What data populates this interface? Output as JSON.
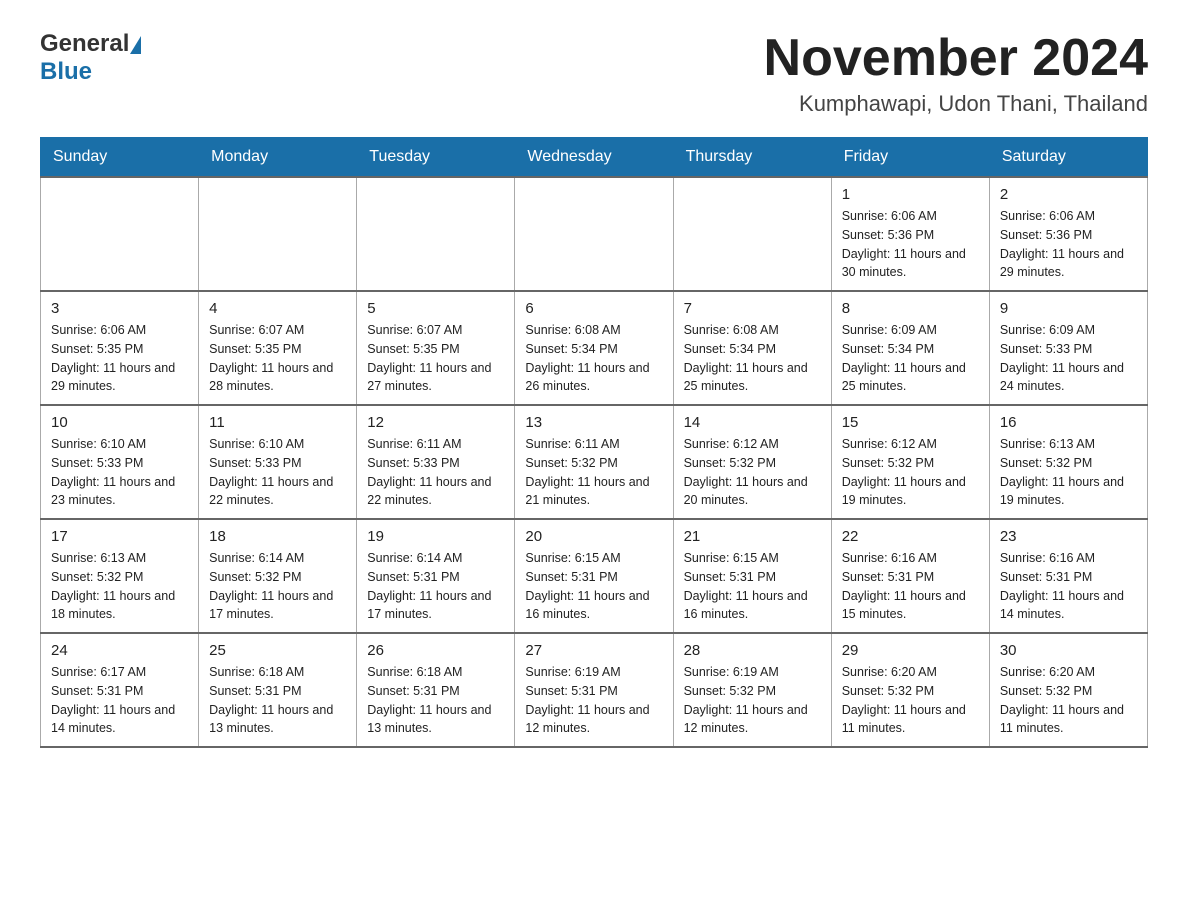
{
  "header": {
    "logo_general": "General",
    "logo_blue": "Blue",
    "title": "November 2024",
    "location": "Kumphawapi, Udon Thani, Thailand"
  },
  "days_of_week": [
    "Sunday",
    "Monday",
    "Tuesday",
    "Wednesday",
    "Thursday",
    "Friday",
    "Saturday"
  ],
  "weeks": [
    [
      {
        "day": "",
        "info": ""
      },
      {
        "day": "",
        "info": ""
      },
      {
        "day": "",
        "info": ""
      },
      {
        "day": "",
        "info": ""
      },
      {
        "day": "",
        "info": ""
      },
      {
        "day": "1",
        "info": "Sunrise: 6:06 AM\nSunset: 5:36 PM\nDaylight: 11 hours\nand 30 minutes."
      },
      {
        "day": "2",
        "info": "Sunrise: 6:06 AM\nSunset: 5:36 PM\nDaylight: 11 hours\nand 29 minutes."
      }
    ],
    [
      {
        "day": "3",
        "info": "Sunrise: 6:06 AM\nSunset: 5:35 PM\nDaylight: 11 hours\nand 29 minutes."
      },
      {
        "day": "4",
        "info": "Sunrise: 6:07 AM\nSunset: 5:35 PM\nDaylight: 11 hours\nand 28 minutes."
      },
      {
        "day": "5",
        "info": "Sunrise: 6:07 AM\nSunset: 5:35 PM\nDaylight: 11 hours\nand 27 minutes."
      },
      {
        "day": "6",
        "info": "Sunrise: 6:08 AM\nSunset: 5:34 PM\nDaylight: 11 hours\nand 26 minutes."
      },
      {
        "day": "7",
        "info": "Sunrise: 6:08 AM\nSunset: 5:34 PM\nDaylight: 11 hours\nand 25 minutes."
      },
      {
        "day": "8",
        "info": "Sunrise: 6:09 AM\nSunset: 5:34 PM\nDaylight: 11 hours\nand 25 minutes."
      },
      {
        "day": "9",
        "info": "Sunrise: 6:09 AM\nSunset: 5:33 PM\nDaylight: 11 hours\nand 24 minutes."
      }
    ],
    [
      {
        "day": "10",
        "info": "Sunrise: 6:10 AM\nSunset: 5:33 PM\nDaylight: 11 hours\nand 23 minutes."
      },
      {
        "day": "11",
        "info": "Sunrise: 6:10 AM\nSunset: 5:33 PM\nDaylight: 11 hours\nand 22 minutes."
      },
      {
        "day": "12",
        "info": "Sunrise: 6:11 AM\nSunset: 5:33 PM\nDaylight: 11 hours\nand 22 minutes."
      },
      {
        "day": "13",
        "info": "Sunrise: 6:11 AM\nSunset: 5:32 PM\nDaylight: 11 hours\nand 21 minutes."
      },
      {
        "day": "14",
        "info": "Sunrise: 6:12 AM\nSunset: 5:32 PM\nDaylight: 11 hours\nand 20 minutes."
      },
      {
        "day": "15",
        "info": "Sunrise: 6:12 AM\nSunset: 5:32 PM\nDaylight: 11 hours\nand 19 minutes."
      },
      {
        "day": "16",
        "info": "Sunrise: 6:13 AM\nSunset: 5:32 PM\nDaylight: 11 hours\nand 19 minutes."
      }
    ],
    [
      {
        "day": "17",
        "info": "Sunrise: 6:13 AM\nSunset: 5:32 PM\nDaylight: 11 hours\nand 18 minutes."
      },
      {
        "day": "18",
        "info": "Sunrise: 6:14 AM\nSunset: 5:32 PM\nDaylight: 11 hours\nand 17 minutes."
      },
      {
        "day": "19",
        "info": "Sunrise: 6:14 AM\nSunset: 5:31 PM\nDaylight: 11 hours\nand 17 minutes."
      },
      {
        "day": "20",
        "info": "Sunrise: 6:15 AM\nSunset: 5:31 PM\nDaylight: 11 hours\nand 16 minutes."
      },
      {
        "day": "21",
        "info": "Sunrise: 6:15 AM\nSunset: 5:31 PM\nDaylight: 11 hours\nand 16 minutes."
      },
      {
        "day": "22",
        "info": "Sunrise: 6:16 AM\nSunset: 5:31 PM\nDaylight: 11 hours\nand 15 minutes."
      },
      {
        "day": "23",
        "info": "Sunrise: 6:16 AM\nSunset: 5:31 PM\nDaylight: 11 hours\nand 14 minutes."
      }
    ],
    [
      {
        "day": "24",
        "info": "Sunrise: 6:17 AM\nSunset: 5:31 PM\nDaylight: 11 hours\nand 14 minutes."
      },
      {
        "day": "25",
        "info": "Sunrise: 6:18 AM\nSunset: 5:31 PM\nDaylight: 11 hours\nand 13 minutes."
      },
      {
        "day": "26",
        "info": "Sunrise: 6:18 AM\nSunset: 5:31 PM\nDaylight: 11 hours\nand 13 minutes."
      },
      {
        "day": "27",
        "info": "Sunrise: 6:19 AM\nSunset: 5:31 PM\nDaylight: 11 hours\nand 12 minutes."
      },
      {
        "day": "28",
        "info": "Sunrise: 6:19 AM\nSunset: 5:32 PM\nDaylight: 11 hours\nand 12 minutes."
      },
      {
        "day": "29",
        "info": "Sunrise: 6:20 AM\nSunset: 5:32 PM\nDaylight: 11 hours\nand 11 minutes."
      },
      {
        "day": "30",
        "info": "Sunrise: 6:20 AM\nSunset: 5:32 PM\nDaylight: 11 hours\nand 11 minutes."
      }
    ]
  ]
}
